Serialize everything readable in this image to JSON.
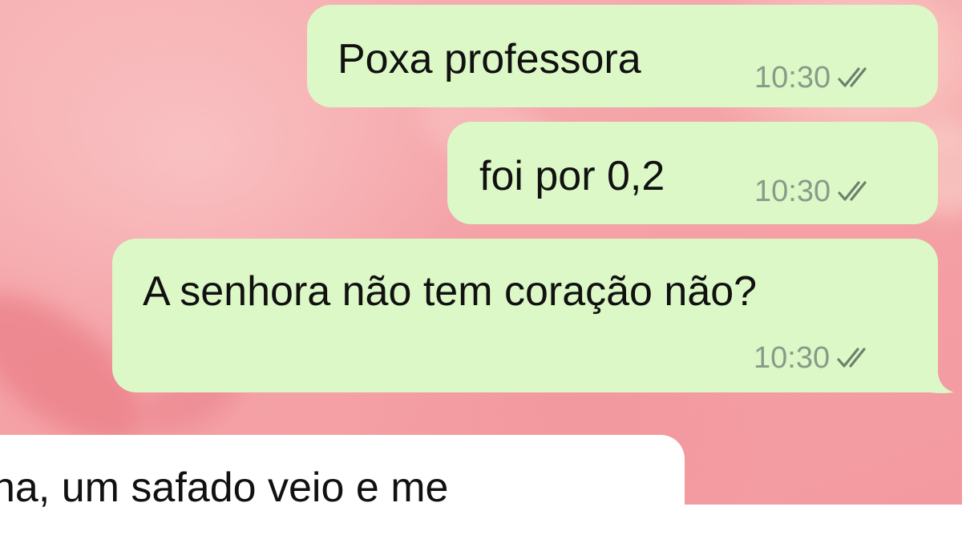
{
  "chat": {
    "messages": [
      {
        "direction": "outgoing",
        "text": "Poxa professora",
        "time": "10:30",
        "status": "read-double-check-icon"
      },
      {
        "direction": "outgoing",
        "text": "foi por 0,2",
        "time": "10:30",
        "status": "read-double-check-icon"
      },
      {
        "direction": "outgoing",
        "text": "A senhora não tem coração não?",
        "time": "10:30",
        "status": "read-double-check-icon"
      },
      {
        "direction": "incoming",
        "text": "na, um safado veio e me"
      }
    ]
  },
  "colors": {
    "outgoing_bubble": "#dcf8c6",
    "incoming_bubble": "#ffffff",
    "wallpaper": "#f4a3a7",
    "timestamp": "#8a9a8a"
  }
}
